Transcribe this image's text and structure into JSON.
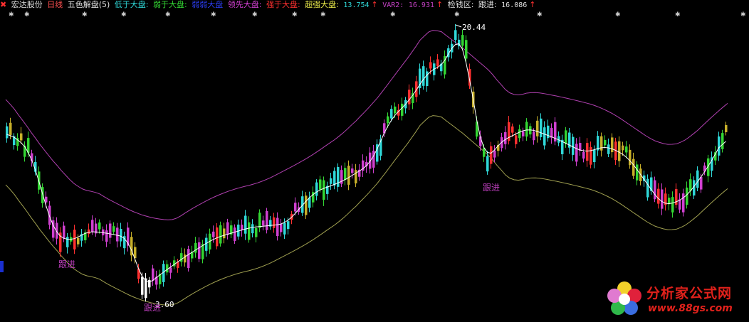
{
  "header": {
    "stock_name": "宏达股份",
    "period": "日线",
    "indicator": "五色解盘(5)",
    "items": [
      {
        "label": "低于大盘:",
        "color": "#2fd8d8"
      },
      {
        "label": "弱于大盘:",
        "color": "#33d633"
      },
      {
        "label": "弱弱大盘",
        "color": "#2b3df0"
      },
      {
        "label": "领先大盘:",
        "color": "#d040d0"
      },
      {
        "label": "强于大盘:",
        "color": "#ff3030"
      },
      {
        "label": "超强大盘:",
        "color": "#e8e84a"
      }
    ],
    "value_1": "13.754",
    "var2_label": "VAR2:",
    "var2_value": "16.931",
    "zone_label": "检钱区:",
    "follow_label": "跟进:",
    "follow_value": "16.086",
    "arrow": "↑"
  },
  "chart_data": {
    "type": "candlestick",
    "series": [
      {
        "name": "K线"
      },
      {
        "name": "均线",
        "color": "#ffffff"
      },
      {
        "name": "上轨",
        "color": "#b040b0"
      },
      {
        "name": "下轨",
        "color": "#a0a050"
      }
    ],
    "annotations": [
      {
        "text": "20.44",
        "kind": "high"
      },
      {
        "text": "3.60",
        "kind": "low"
      },
      {
        "text": "跟进"
      },
      {
        "text": "跟进"
      },
      {
        "text": "跟进"
      }
    ],
    "grid": false
  },
  "logo": {
    "text": "分析家公式网",
    "url": "www.88gs.com"
  },
  "colors": {
    "cyan": "#2fd8d8",
    "green": "#33d633",
    "blue": "#2b3df0",
    "magenta": "#d040d0",
    "red": "#ff3030",
    "yellow": "#c8b02a",
    "white": "#ffffff",
    "upper": "#b040b0",
    "lower": "#a0a050"
  }
}
